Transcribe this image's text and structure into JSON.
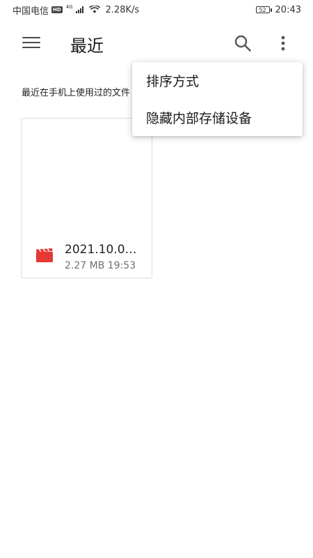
{
  "status_bar": {
    "carrier": "中国电信",
    "hd": "HD",
    "network_type": "4G",
    "speed": "2.28K/s",
    "battery": "52",
    "time": "20:43"
  },
  "toolbar": {
    "title": "最近",
    "menu_icon": "hamburger-menu-icon",
    "search_icon": "search-icon",
    "more_icon": "more-vert-icon"
  },
  "main": {
    "description": "最近在手机上使用过的文件",
    "files": [
      {
        "name": "2021.10.0…",
        "size": "2.27 MB",
        "time": "19:53",
        "icon": "video-icon",
        "icon_color": "#e53935"
      }
    ]
  },
  "dropdown_menu": {
    "items": [
      {
        "label": "排序方式"
      },
      {
        "label": "隐藏内部存储设备"
      }
    ]
  }
}
